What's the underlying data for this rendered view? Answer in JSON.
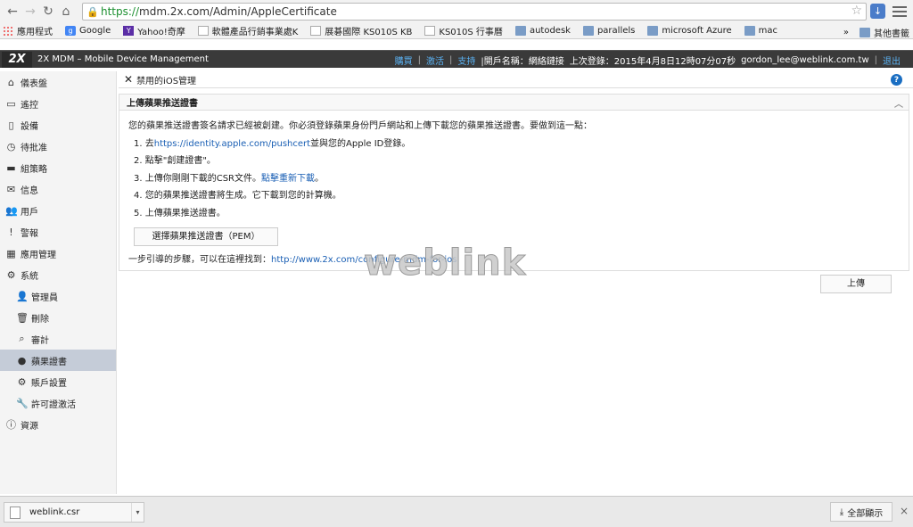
{
  "browser": {
    "url_scheme": "https://",
    "url_rest": "mdm.2x.com/Admin/AppleCertificate",
    "icons": {
      "back": "back-arrow-icon",
      "forward": "forward-arrow-icon",
      "reload": "reload-icon",
      "home": "home-icon",
      "star": "star-icon",
      "menu": "menu-icon"
    }
  },
  "bookmarks": {
    "items": [
      {
        "label": "應用程式",
        "icon": "apps"
      },
      {
        "label": "Google",
        "icon": "google"
      },
      {
        "label": "Yahoo!奇摩",
        "icon": "yahoo"
      },
      {
        "label": "軟體產品行銷事業處K",
        "icon": "page"
      },
      {
        "label": "展碁國際 KS010S KB",
        "icon": "page"
      },
      {
        "label": "KS010S 行事曆",
        "icon": "page"
      },
      {
        "label": "autodesk",
        "icon": "folder"
      },
      {
        "label": "parallels",
        "icon": "folder"
      },
      {
        "label": "microsoft Azure",
        "icon": "folder"
      },
      {
        "label": "mac",
        "icon": "folder"
      }
    ],
    "overflow": "»",
    "other": "其他書籤"
  },
  "header": {
    "logo": "2X",
    "title": "2X MDM – Mobile Device Management",
    "buy": "購買",
    "activate": "激活",
    "support": "支持",
    "account_label": "|開戶名稱：網絡鏈接",
    "last_login": "上次登錄：2015年4月8日12時07分07秒",
    "user": "gordon_lee@weblink.com.tw",
    "logout": "退出",
    "sep": "|"
  },
  "sidebar": {
    "items": [
      {
        "label": "儀表盤",
        "icon": "home-icon",
        "sub": false
      },
      {
        "label": "遙控",
        "icon": "monitor-icon",
        "sub": false
      },
      {
        "label": "設備",
        "icon": "phone-icon",
        "sub": false
      },
      {
        "label": "待批准",
        "icon": "clock-icon",
        "sub": false
      },
      {
        "label": "組策略",
        "icon": "folder-icon",
        "sub": false
      },
      {
        "label": "信息",
        "icon": "envelope-icon",
        "sub": false
      },
      {
        "label": "用戶",
        "icon": "users-icon",
        "sub": false
      },
      {
        "label": "警報",
        "icon": "alert-icon",
        "sub": false
      },
      {
        "label": "應用管理",
        "icon": "apps-icon",
        "sub": false
      },
      {
        "label": "系統",
        "icon": "gears-icon",
        "sub": false
      },
      {
        "label": "管理員",
        "icon": "admin-user-icon",
        "sub": true
      },
      {
        "label": "刪除",
        "icon": "trash-icon",
        "sub": true
      },
      {
        "label": "審計",
        "icon": "audit-icon",
        "sub": true
      },
      {
        "label": "蘋果證書",
        "icon": "apple-cert-icon",
        "sub": true,
        "active": true
      },
      {
        "label": "賬戶設置",
        "icon": "gear-icon",
        "sub": true
      },
      {
        "label": "許可證激活",
        "icon": "key-icon",
        "sub": true
      },
      {
        "label": "資源",
        "icon": "info-icon",
        "sub": false
      }
    ]
  },
  "main": {
    "tab_label": "禁用的iOS管理",
    "panel_title": "上傳蘋果推送證書",
    "intro": "您的蘋果推送證書簽名請求已經被創建。你必須登錄蘋果身份門戶網站和上傳下載您的蘋果推送證書。要做到這一點：",
    "step1_pre": "1. 去",
    "step1_link": "https://identity.apple.com/pushcert",
    "step1_post": "並與您的Apple ID登錄。",
    "step2": "2. 點擊\"創建證書\"。",
    "step3_pre": "3. 上傳你剛剛下載的CSR文件。",
    "step3_link": "點擊重新下載",
    "step3_post": "。",
    "step4": "4. 您的蘋果推送證書將生成。它下載到您的計算機。",
    "step5": "5. 上傳蘋果推送證書。",
    "pem_button": "選擇蘋果推送證書（PEM）",
    "guide_pre": "一步引導的步驟，可以在這裡找到：",
    "guide_link": "http://www.2x.com/configure-mdm-for-ios",
    "upload_button": "上傳",
    "watermark": "weblink"
  },
  "download_bar": {
    "file": "weblink.csr",
    "show_all": "全部顯示",
    "close": "×"
  },
  "colors": {
    "header_bg": "#3a3a3a",
    "link": "#1a5fb4",
    "active_sidebar": "#c5ccd8"
  }
}
